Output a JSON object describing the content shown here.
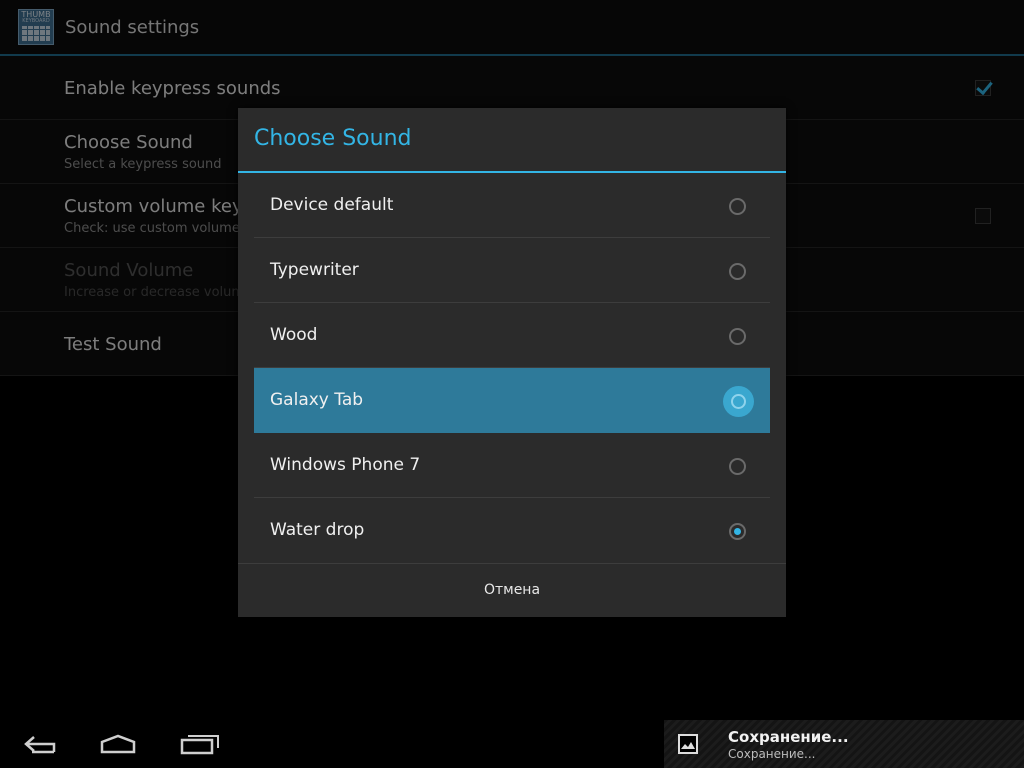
{
  "app": {
    "icon_text": "THUMB",
    "icon_subtext": "KEYBOARD",
    "title": "Sound settings"
  },
  "preferences": [
    {
      "title": "Enable keypress sounds",
      "summary": "",
      "checkbox": true,
      "checked": true
    },
    {
      "title": "Choose Sound",
      "summary": "Select a keypress sound"
    },
    {
      "title": "Custom volume keypre",
      "summary": "Check: use custom volume/U",
      "checkbox": true,
      "checked": false
    },
    {
      "title": "Sound Volume",
      "summary": "Increase or decrease volume",
      "disabled": true
    },
    {
      "title": "Test Sound",
      "summary": ""
    }
  ],
  "dialog": {
    "title": "Choose Sound",
    "options": [
      {
        "label": "Device default",
        "selected": false
      },
      {
        "label": "Typewriter",
        "selected": false
      },
      {
        "label": "Wood",
        "selected": false
      },
      {
        "label": "Galaxy Tab",
        "selected": false,
        "highlighted": true
      },
      {
        "label": "Windows Phone 7",
        "selected": false
      },
      {
        "label": "Water drop",
        "selected": true
      }
    ],
    "cancel_label": "Отмена"
  },
  "navbar": {
    "icons": [
      "back-icon",
      "home-icon",
      "recent-apps-icon"
    ]
  },
  "notification": {
    "icon": "image-icon",
    "title": "Сохранение...",
    "subtitle": "Сохранение..."
  },
  "colors": {
    "accent": "#33b5e5",
    "highlight": "#2e7a9a"
  }
}
